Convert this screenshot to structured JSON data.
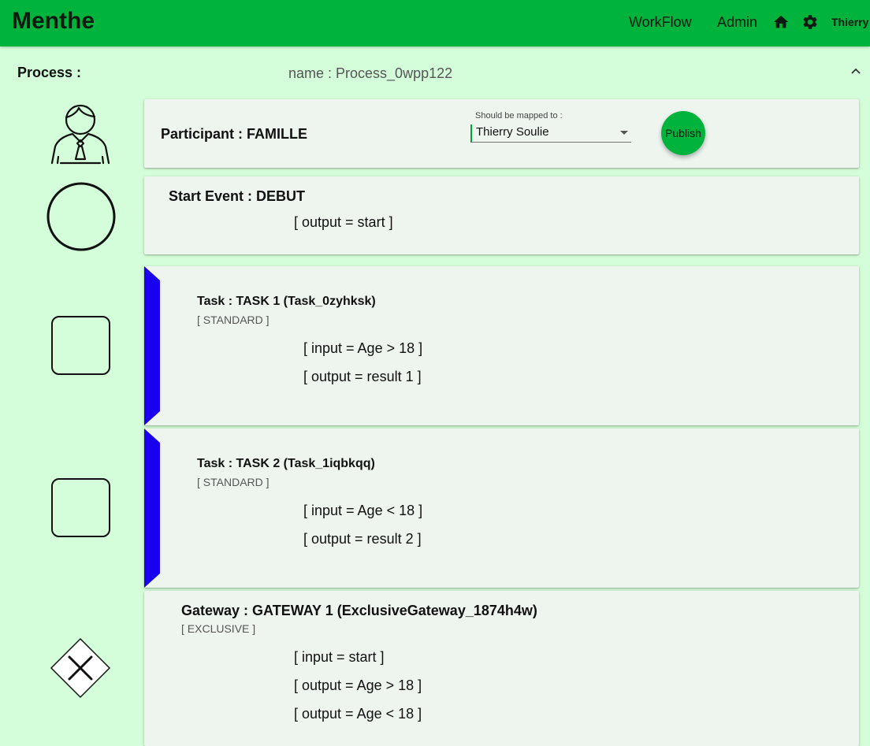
{
  "app": {
    "brand": "Menthe",
    "nav": {
      "workflow": "WorkFlow",
      "admin": "Admin"
    },
    "icons": {
      "home": "home-icon",
      "settings": "gear-icon"
    },
    "user": "Thierry",
    "accent_color": "#00b33c",
    "background_color": "#d4fdd9",
    "marker_color": "#1a00f0"
  },
  "process": {
    "label": "Process :",
    "name": "name : Process_0wpp122"
  },
  "participant": {
    "title": "Participant : FAMILLE",
    "mapping_label": "Should be mapped to :",
    "mapping_value": "Thierry Soulie",
    "publish_label": "Publish"
  },
  "start_event": {
    "title": "Start Event : DEBUT",
    "output": "[ output = start ]"
  },
  "tasks": [
    {
      "title": "Task : TASK 1 (Task_0zyhksk)",
      "type": "[ STANDARD ]",
      "input": "[ input = Age > 18 ]",
      "output": "[ output = result 1 ]"
    },
    {
      "title": "Task : TASK 2 (Task_1iqbkqq)",
      "type": "[ STANDARD ]",
      "input": "[ input = Age < 18 ]",
      "output": "[ output = result 2 ]"
    }
  ],
  "gateway": {
    "title": "Gateway : GATEWAY 1 (ExclusiveGateway_1874h4w)",
    "type": "[ EXCLUSIVE ]",
    "input": "[ input = start ]",
    "outputs": [
      "[ output = Age > 18 ]",
      "[ output = Age < 18 ]"
    ]
  }
}
